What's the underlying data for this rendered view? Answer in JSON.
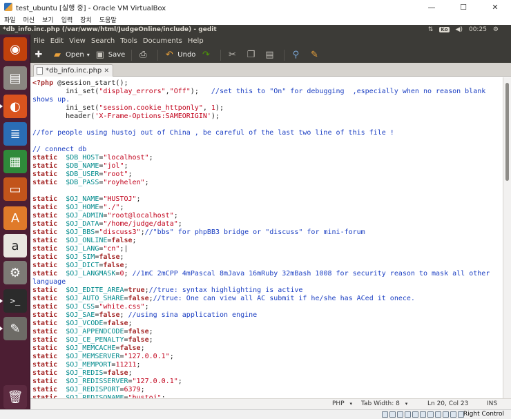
{
  "vbox": {
    "title": "test_ubuntu [실행 중] - Oracle VM VirtualBox",
    "menu": [
      "파일",
      "머신",
      "보기",
      "입력",
      "장치",
      "도움말"
    ],
    "controls": {
      "minimize": "—",
      "maximize": "☐",
      "close": "✕"
    },
    "host_key": "Right Control"
  },
  "panel": {
    "window_title": "*db_info.inc.php (/var/www/html/JudgeOnline/include) - gedit",
    "keyboard": "Ko",
    "clock": "00:25",
    "icons": {
      "network": "updown-arrows-icon",
      "volume": "volume-icon",
      "power": "gear-icon"
    }
  },
  "gedit": {
    "menu": [
      "File",
      "Edit",
      "View",
      "Search",
      "Tools",
      "Documents",
      "Help"
    ],
    "toolbar": {
      "open_label": "Open",
      "save_label": "Save",
      "undo_label": "Undo"
    },
    "tab_label": "*db_info.inc.php",
    "status": {
      "language": "PHP",
      "tab_width": "Tab Width: 8",
      "position": "Ln 20, Col 23",
      "mode": "INS"
    }
  },
  "code_lines": [
    [
      [
        "kw",
        "<?php"
      ],
      [
        "txt",
        " @session_start();"
      ]
    ],
    [
      [
        "txt",
        "        ini_set("
      ],
      [
        "str",
        "\"display_errors\""
      ],
      [
        "txt",
        ","
      ],
      [
        "str",
        "\"Off\""
      ],
      [
        "txt",
        ");   "
      ],
      [
        "cm",
        "//set this to \"On\" for debugging  ,especially when no reason blank"
      ]
    ],
    [
      [
        "cm",
        "shows up."
      ]
    ],
    [
      [
        "txt",
        "        ini_set("
      ],
      [
        "str",
        "\"session.cookie_httponly\""
      ],
      [
        "txt",
        ", "
      ],
      [
        "num",
        "1"
      ],
      [
        "txt",
        ");"
      ]
    ],
    [
      [
        "txt",
        "        header("
      ],
      [
        "str",
        "'X-Frame-Options:SAMEORIGIN'"
      ],
      [
        "txt",
        ");"
      ]
    ],
    [],
    [
      [
        "cm",
        "//for people using hustoj out of China , be careful of the last two line of this file !"
      ]
    ],
    [],
    [
      [
        "cm",
        "// connect db"
      ]
    ],
    [
      [
        "kw",
        "static"
      ],
      [
        "txt",
        "  "
      ],
      [
        "var",
        "$DB_HOST"
      ],
      [
        "txt",
        "="
      ],
      [
        "str",
        "\"localhost\""
      ],
      [
        "txt",
        ";"
      ]
    ],
    [
      [
        "kw",
        "static"
      ],
      [
        "txt",
        "  "
      ],
      [
        "var",
        "$DB_NAME"
      ],
      [
        "txt",
        "="
      ],
      [
        "str",
        "\"jol\""
      ],
      [
        "txt",
        ";"
      ]
    ],
    [
      [
        "kw",
        "static"
      ],
      [
        "txt",
        "  "
      ],
      [
        "var",
        "$DB_USER"
      ],
      [
        "txt",
        "="
      ],
      [
        "str",
        "\"root\""
      ],
      [
        "txt",
        ";"
      ]
    ],
    [
      [
        "kw",
        "static"
      ],
      [
        "txt",
        "  "
      ],
      [
        "var",
        "$DB_PASS"
      ],
      [
        "txt",
        "="
      ],
      [
        "str",
        "\"royhelen\""
      ],
      [
        "txt",
        ";"
      ]
    ],
    [],
    [
      [
        "kw",
        "static"
      ],
      [
        "txt",
        "  "
      ],
      [
        "var",
        "$OJ_NAME"
      ],
      [
        "txt",
        "="
      ],
      [
        "str",
        "\"HUSTOJ\""
      ],
      [
        "txt",
        ";"
      ]
    ],
    [
      [
        "kw",
        "static"
      ],
      [
        "txt",
        "  "
      ],
      [
        "var",
        "$OJ_HOME"
      ],
      [
        "txt",
        "="
      ],
      [
        "str",
        "\"./\""
      ],
      [
        "txt",
        ";"
      ]
    ],
    [
      [
        "kw",
        "static"
      ],
      [
        "txt",
        "  "
      ],
      [
        "var",
        "$OJ_ADMIN"
      ],
      [
        "txt",
        "="
      ],
      [
        "str",
        "\"root@localhost\""
      ],
      [
        "txt",
        ";"
      ]
    ],
    [
      [
        "kw",
        "static"
      ],
      [
        "txt",
        "  "
      ],
      [
        "var",
        "$OJ_DATA"
      ],
      [
        "txt",
        "="
      ],
      [
        "str",
        "\"/home/judge/data\""
      ],
      [
        "txt",
        ";"
      ]
    ],
    [
      [
        "kw",
        "static"
      ],
      [
        "txt",
        "  "
      ],
      [
        "var",
        "$OJ_BBS"
      ],
      [
        "txt",
        "="
      ],
      [
        "str",
        "\"discuss3\""
      ],
      [
        "txt",
        ";"
      ],
      [
        "cm",
        "//\"bbs\" for phpBB3 bridge or \"discuss\" for mini-forum"
      ]
    ],
    [
      [
        "kw",
        "static"
      ],
      [
        "txt",
        "  "
      ],
      [
        "var",
        "$OJ_ONLINE"
      ],
      [
        "txt",
        "="
      ],
      [
        "kw",
        "false"
      ],
      [
        "txt",
        ";"
      ]
    ],
    [
      [
        "kw",
        "static"
      ],
      [
        "txt",
        "  "
      ],
      [
        "var",
        "$OJ_LANG"
      ],
      [
        "txt",
        "="
      ],
      [
        "str",
        "\"cn\""
      ],
      [
        "txt",
        ";|"
      ]
    ],
    [
      [
        "kw",
        "static"
      ],
      [
        "txt",
        "  "
      ],
      [
        "var",
        "$OJ_SIM"
      ],
      [
        "txt",
        "="
      ],
      [
        "kw",
        "false"
      ],
      [
        "txt",
        ";"
      ]
    ],
    [
      [
        "kw",
        "static"
      ],
      [
        "txt",
        "  "
      ],
      [
        "var",
        "$OJ_DICT"
      ],
      [
        "txt",
        "="
      ],
      [
        "kw",
        "false"
      ],
      [
        "txt",
        ";"
      ]
    ],
    [
      [
        "kw",
        "static"
      ],
      [
        "txt",
        "  "
      ],
      [
        "var",
        "$OJ_LANGMASK"
      ],
      [
        "txt",
        "="
      ],
      [
        "num",
        "0"
      ],
      [
        "txt",
        "; "
      ],
      [
        "cm",
        "//1mC 2mCPP 4mPascal 8mJava 16mRuby 32mBash 1008 for security reason to mask all other"
      ]
    ],
    [
      [
        "cm",
        "language"
      ]
    ],
    [
      [
        "kw",
        "static"
      ],
      [
        "txt",
        "  "
      ],
      [
        "var",
        "$OJ_EDITE_AREA"
      ],
      [
        "txt",
        "="
      ],
      [
        "kw",
        "true"
      ],
      [
        "txt",
        ";"
      ],
      [
        "cm",
        "//true: syntax highlighting is active"
      ]
    ],
    [
      [
        "kw",
        "static"
      ],
      [
        "txt",
        "  "
      ],
      [
        "var",
        "$OJ_AUTO_SHARE"
      ],
      [
        "txt",
        "="
      ],
      [
        "kw",
        "false"
      ],
      [
        "txt",
        ";"
      ],
      [
        "cm",
        "//true: One can view all AC submit if he/she has ACed it onece."
      ]
    ],
    [
      [
        "kw",
        "static"
      ],
      [
        "txt",
        "  "
      ],
      [
        "var",
        "$OJ_CSS"
      ],
      [
        "txt",
        "="
      ],
      [
        "str",
        "\"white.css\""
      ],
      [
        "txt",
        ";"
      ]
    ],
    [
      [
        "kw",
        "static"
      ],
      [
        "txt",
        "  "
      ],
      [
        "var",
        "$OJ_SAE"
      ],
      [
        "txt",
        "="
      ],
      [
        "kw",
        "false"
      ],
      [
        "txt",
        "; "
      ],
      [
        "cm",
        "//using sina application engine"
      ]
    ],
    [
      [
        "kw",
        "static"
      ],
      [
        "txt",
        "  "
      ],
      [
        "var",
        "$OJ_VCODE"
      ],
      [
        "txt",
        "="
      ],
      [
        "kw",
        "false"
      ],
      [
        "txt",
        ";"
      ]
    ],
    [
      [
        "kw",
        "static"
      ],
      [
        "txt",
        "  "
      ],
      [
        "var",
        "$OJ_APPENDCODE"
      ],
      [
        "txt",
        "="
      ],
      [
        "kw",
        "false"
      ],
      [
        "txt",
        ";"
      ]
    ],
    [
      [
        "kw",
        "static"
      ],
      [
        "txt",
        "  "
      ],
      [
        "var",
        "$OJ_CE_PENALTY"
      ],
      [
        "txt",
        "="
      ],
      [
        "kw",
        "false"
      ],
      [
        "txt",
        ";"
      ]
    ],
    [
      [
        "kw",
        "static"
      ],
      [
        "txt",
        "  "
      ],
      [
        "var",
        "$OJ_MEMCACHE"
      ],
      [
        "txt",
        "="
      ],
      [
        "kw",
        "false"
      ],
      [
        "txt",
        ";"
      ]
    ],
    [
      [
        "kw",
        "static"
      ],
      [
        "txt",
        "  "
      ],
      [
        "var",
        "$OJ_MEMSERVER"
      ],
      [
        "txt",
        "="
      ],
      [
        "str",
        "\"127.0.0.1\""
      ],
      [
        "txt",
        ";"
      ]
    ],
    [
      [
        "kw",
        "static"
      ],
      [
        "txt",
        "  "
      ],
      [
        "var",
        "$OJ_MEMPORT"
      ],
      [
        "txt",
        "="
      ],
      [
        "num",
        "11211"
      ],
      [
        "txt",
        ";"
      ]
    ],
    [
      [
        "kw",
        "static"
      ],
      [
        "txt",
        "  "
      ],
      [
        "var",
        "$OJ_REDIS"
      ],
      [
        "txt",
        "="
      ],
      [
        "kw",
        "false"
      ],
      [
        "txt",
        ";"
      ]
    ],
    [
      [
        "kw",
        "static"
      ],
      [
        "txt",
        "  "
      ],
      [
        "var",
        "$OJ_REDISSERVER"
      ],
      [
        "txt",
        "="
      ],
      [
        "str",
        "\"127.0.0.1\""
      ],
      [
        "txt",
        ";"
      ]
    ],
    [
      [
        "kw",
        "static"
      ],
      [
        "txt",
        "  "
      ],
      [
        "var",
        "$OJ_REDISPORT"
      ],
      [
        "txt",
        "="
      ],
      [
        "num",
        "6379"
      ],
      [
        "txt",
        ";"
      ]
    ],
    [
      [
        "kw",
        "static"
      ],
      [
        "txt",
        "  "
      ],
      [
        "var",
        "$OJ_REDISQNAME"
      ],
      [
        "txt",
        "="
      ],
      [
        "str",
        "\"hustoj\""
      ],
      [
        "txt",
        ";"
      ]
    ]
  ],
  "launcher": [
    {
      "name": "ubuntu-dash-icon",
      "glyph": "◉",
      "bg": "#c2410c"
    },
    {
      "name": "file-manager-icon",
      "glyph": "▤",
      "bg": "#8a8680"
    },
    {
      "name": "firefox-icon",
      "glyph": "◐",
      "bg": "#d9531e"
    },
    {
      "name": "writer-icon",
      "glyph": "≣",
      "bg": "#2a6db5"
    },
    {
      "name": "calc-icon",
      "glyph": "▦",
      "bg": "#2f8a3a"
    },
    {
      "name": "impress-icon",
      "glyph": "▭",
      "bg": "#c2541b"
    },
    {
      "name": "software-center-icon",
      "glyph": "A",
      "bg": "#e07a2a"
    },
    {
      "name": "amazon-icon",
      "glyph": "a",
      "bg": "#e9e6e0"
    },
    {
      "name": "settings-icon",
      "glyph": "⚙",
      "bg": "#7d7a75"
    },
    {
      "name": "terminal-icon",
      "glyph": ">_",
      "bg": "#2b2b2b"
    },
    {
      "name": "text-editor-icon",
      "glyph": "✎",
      "bg": "#6d6b66"
    },
    {
      "name": "trash-icon",
      "glyph": "🗑",
      "bg": "#5c2a40"
    }
  ]
}
